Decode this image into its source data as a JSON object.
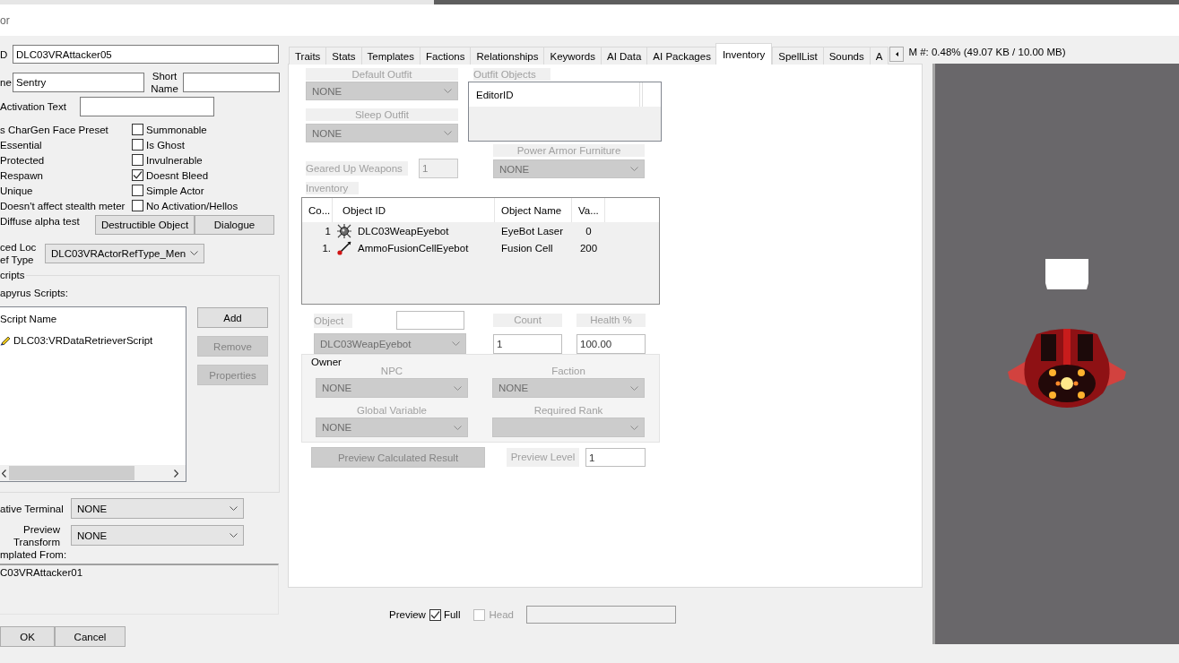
{
  "window": {
    "title": "or"
  },
  "left_panel": {
    "id_field": {
      "label": "D",
      "value": "DLC03VRAttacker05"
    },
    "name_field": {
      "label": "ne",
      "value": "Sentry"
    },
    "short_name_field": {
      "label_lines": [
        "Short",
        "Name"
      ]
    },
    "activation_text_field": {
      "label": "Activation Text"
    },
    "flag_rows": [
      {
        "left_label": "s CharGen Face Preset",
        "label": "Summonable",
        "checked": false
      },
      {
        "left_label": "Essential",
        "label": "Is Ghost",
        "checked": false
      },
      {
        "left_label": "Protected",
        "label": "Invulnerable",
        "checked": false
      },
      {
        "left_label": "Respawn",
        "label": "Doesnt Bleed",
        "checked": true
      },
      {
        "left_label": "Unique",
        "label": "Simple Actor",
        "checked": false
      },
      {
        "left_label": "Doesn't affect stealth meter",
        "label": "No Activation/Hellos",
        "checked": false
      }
    ],
    "button_row": {
      "left_label": "Diffuse alpha test",
      "buttons": [
        "Destructible Object",
        "Dialogue"
      ]
    },
    "ref_type": {
      "label_lines": [
        "ced Loc",
        "ef Type"
      ],
      "value": "DLC03VRActorRefType_Men"
    },
    "scripts": {
      "title": "cripts",
      "list_label": "apyrus Scripts:",
      "column": "Script Name",
      "rows": [
        "DLC03:VRDataRetrieverScript"
      ],
      "buttons": [
        {
          "label": "Add",
          "disabled": false
        },
        {
          "label": "Remove",
          "disabled": true
        },
        {
          "label": "Properties",
          "disabled": true
        }
      ]
    },
    "terminal": {
      "label": "ative Terminal",
      "value": "NONE"
    },
    "preview_transform": {
      "label_lines": [
        "Preview",
        "Transform"
      ],
      "value": "NONE"
    },
    "templated_from": {
      "label": "mplated From:",
      "value": "C03VRAttacker01"
    },
    "dialog_buttons": [
      "OK",
      "Cancel"
    ]
  },
  "tabs": [
    {
      "label": "Traits",
      "selected": false
    },
    {
      "label": "Stats",
      "selected": false
    },
    {
      "label": "Templates",
      "selected": false
    },
    {
      "label": "Factions",
      "selected": false
    },
    {
      "label": "Relationships",
      "selected": false
    },
    {
      "label": "Keywords",
      "selected": false
    },
    {
      "label": "AI Data",
      "selected": false
    },
    {
      "label": "AI Packages",
      "selected": false
    },
    {
      "label": "Inventory",
      "selected": true
    },
    {
      "label": "SpellList",
      "selected": false
    },
    {
      "label": "Sounds",
      "selected": false
    },
    {
      "label": "A",
      "selected": false
    }
  ],
  "memory_status": "M #: 0.48% (49.07 KB / 10.00 MB)",
  "inventory_tab": {
    "default_outfit": {
      "label": "Default Outfit",
      "value": "NONE",
      "disabled": true
    },
    "sleep_outfit": {
      "label": "Sleep Outfit",
      "value": "NONE",
      "disabled": true
    },
    "outfit_objects": {
      "label": "Outfit Objects",
      "column": "EditorID"
    },
    "power_armor_furniture": {
      "label": "Power Armor Furniture",
      "value": "NONE",
      "disabled": true
    },
    "geared_up_weapons": {
      "label": "Geared Up Weapons",
      "value": "1",
      "disabled": true
    },
    "inventory": {
      "label": "Inventory",
      "columns": [
        "Co...",
        "Object ID",
        "Object Name",
        "Va..."
      ],
      "rows": [
        {
          "kind": "weapon",
          "count": "1",
          "object_id": "DLC03WeapEyebot",
          "object_name": "EyeBot Laser",
          "value": "0"
        },
        {
          "kind": "ammo",
          "count": "1.",
          "object_id": "AmmoFusionCellEyebot",
          "object_name": "Fusion Cell",
          "value": "200"
        }
      ]
    },
    "object": {
      "label": "Object",
      "value": "DLC03WeapEyebot",
      "disabled": true
    },
    "count": {
      "label": "Count",
      "value": "1",
      "disabled": false
    },
    "health": {
      "label": "Health %",
      "value": "100.00",
      "disabled": false
    },
    "owner": {
      "title": "Owner",
      "captions": [
        "NPC",
        "Faction",
        "Global Variable",
        "Required Rank"
      ],
      "dropdowns": [
        {
          "value": "NONE",
          "disabled": true
        },
        {
          "value": "NONE",
          "disabled": true
        },
        {
          "value": "NONE",
          "disabled": true
        },
        {
          "disabled": true
        }
      ]
    },
    "preview_button": {
      "label": "Preview Calculated Result",
      "disabled": true
    },
    "preview_level": {
      "label": "Preview Level",
      "value": "1",
      "disabled": false
    }
  },
  "preview_controls": {
    "label": "Preview",
    "options": [
      {
        "label": "Full",
        "checked": true,
        "disabled": false
      },
      {
        "label": "Head",
        "checked": false,
        "disabled": true
      }
    ]
  }
}
